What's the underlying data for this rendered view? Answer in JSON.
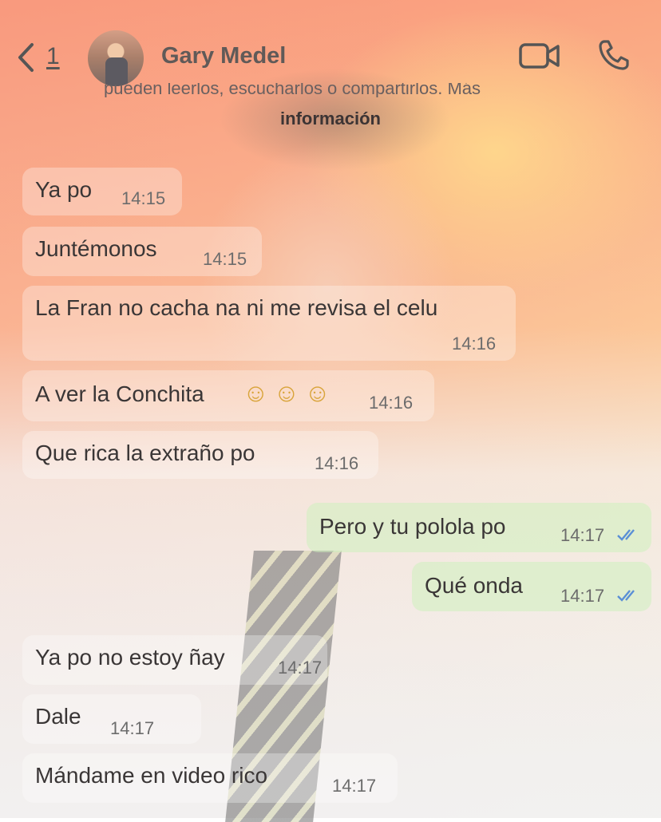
{
  "header": {
    "back_count": "1",
    "contact_name": "Gary Medel"
  },
  "notice": {
    "cut_text": "pueden leerlos, escucharlos o compartirlos. Más",
    "link_text": "información"
  },
  "messages": [
    {
      "direction": "incoming",
      "text": "Ya po",
      "time": "14:15"
    },
    {
      "direction": "incoming",
      "text": "Juntémonos",
      "time": "14:15"
    },
    {
      "direction": "incoming",
      "text": "La Fran no cacha na ni me revisa el celu",
      "time": "14:16"
    },
    {
      "direction": "incoming",
      "text": "A ver la Conchita",
      "emoji": "☺☺☺",
      "time": "14:16"
    },
    {
      "direction": "incoming",
      "text": "Que rica la extraño po",
      "time": "14:16"
    },
    {
      "direction": "outgoing",
      "text": "Pero y tu polola po",
      "time": "14:17",
      "status": "read"
    },
    {
      "direction": "outgoing",
      "text": "Qué onda",
      "time": "14:17",
      "status": "read"
    },
    {
      "direction": "incoming",
      "text": "Ya po no estoy ñay",
      "time": "14:17"
    },
    {
      "direction": "incoming",
      "text": "Dale",
      "time": "14:17"
    },
    {
      "direction": "incoming",
      "text": "Mándame en video rico",
      "time": "14:17"
    }
  ],
  "colors": {
    "read_ticks": "#5a8fd6",
    "outgoing_bubble": "#cdf0be",
    "incoming_bubble": "#ffffff"
  },
  "icons": {
    "back": "chevron-left-icon",
    "video": "video-camera-icon",
    "call": "phone-icon",
    "read": "double-check-icon"
  }
}
